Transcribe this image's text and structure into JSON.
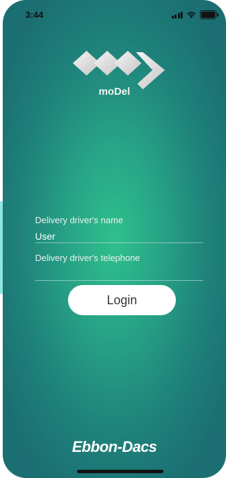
{
  "status_bar": {
    "time": "3:44",
    "icons": [
      "signal-icon",
      "wifi-icon",
      "battery-icon"
    ]
  },
  "logo": {
    "text": "moDel",
    "icon": "model-logo-icon"
  },
  "form": {
    "name_label": "Delivery driver's name",
    "name_value": "User",
    "phone_label": "Delivery driver's telephone",
    "phone_value": "",
    "login_label": "Login"
  },
  "footer": {
    "brand": "Ebbon-Dacs"
  },
  "colors": {
    "background_center": "#2fc08c",
    "background_edge": "#1b6f72",
    "button": "#ffffff"
  }
}
